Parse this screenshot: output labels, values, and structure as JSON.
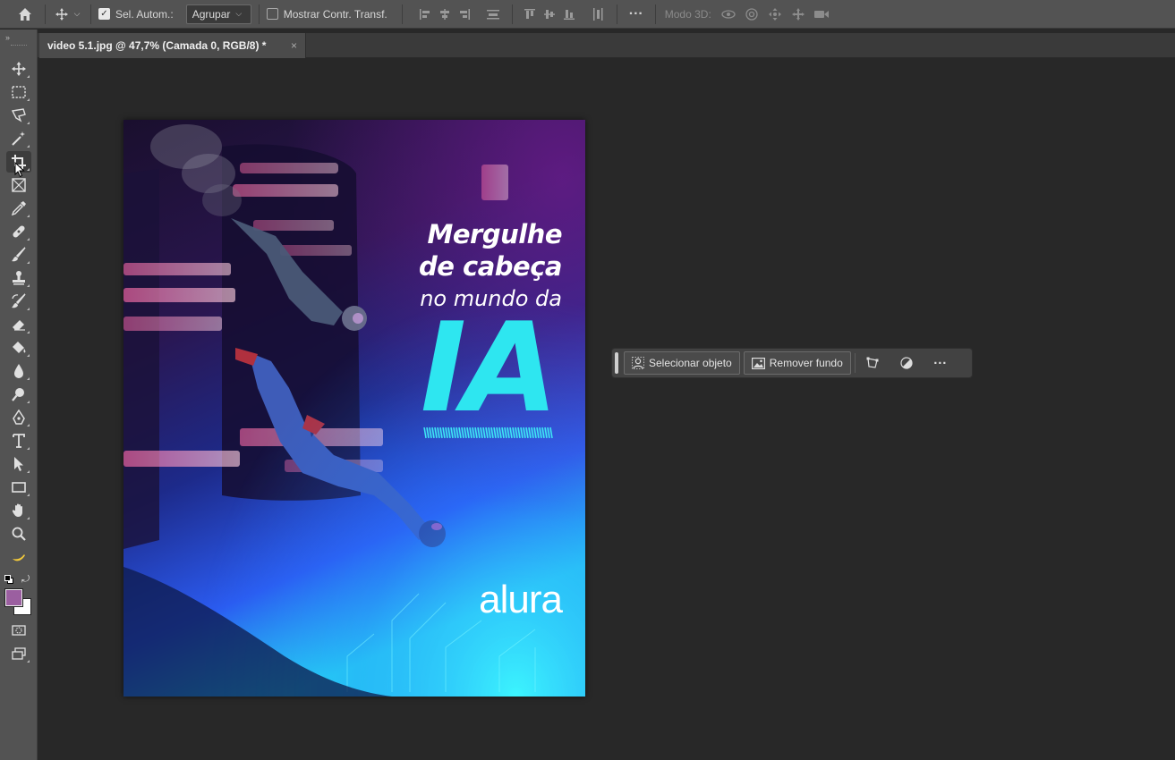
{
  "options_bar": {
    "auto_select_label": "Sel. Autom.:",
    "group_select_value": "Agrupar",
    "show_transform_label": "Mostrar Contr. Transf.",
    "mode3d_label": "Modo 3D:"
  },
  "document": {
    "tab_title": "video 5.1.jpg @ 47,7% (Camada 0, RGB/8) *",
    "close_glyph": "×"
  },
  "poster": {
    "line1": "Mergulhe",
    "line2": "de cabeça",
    "line3": "no mundo da",
    "headline": "IA",
    "brand": "alura"
  },
  "contextual_bar": {
    "select_object_label": "Selecionar objeto",
    "remove_bg_label": "Remover fundo"
  },
  "colors": {
    "foreground": "#9b5fa0",
    "background": "#ffffff",
    "accent_cyan": "#2ee6f0"
  }
}
